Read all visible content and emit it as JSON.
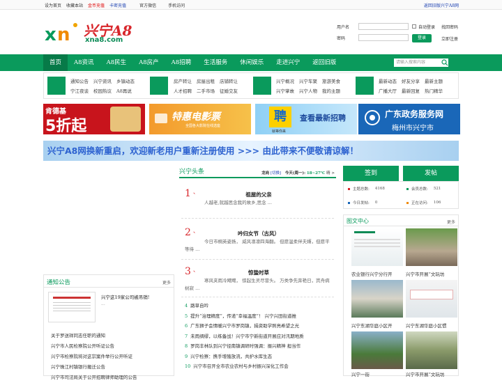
{
  "topbar": {
    "links": [
      "设为首页",
      "收藏本站",
      "金币充值",
      "卡密充值",
      "官方微信",
      "手机访问"
    ],
    "right": "返回旧版兴宁A8网"
  },
  "logo": {
    "cn": "兴宁A8",
    "domain": "xna8.com",
    "mark": "xn"
  },
  "login": {
    "user_label": "用户名",
    "pass_label": "密码",
    "auto_login": "自动登录",
    "find_pass": "找回密码",
    "login_btn": "登录",
    "register": "立即注册"
  },
  "nav": {
    "items": [
      "首页",
      "A8资讯",
      "A8民生",
      "A8房产",
      "A8招聘",
      "生活服务",
      "休闲娱乐",
      "走进兴宁",
      "返回旧版"
    ],
    "search_placeholder": "请输入搜索内容"
  },
  "subnav": {
    "group1": [
      "通知公告",
      "兴宁资讯",
      "乡镇动态",
      "宁江夜谈",
      "校园热议",
      "A8再说"
    ],
    "group2": [
      "房产转让",
      "房屋出租",
      "店铺转让",
      "人才招聘",
      "二手市场",
      "征婚交友"
    ],
    "group3": [
      "兴宁概况",
      "兴宁车聚",
      "旅游美食",
      "兴宁掌故",
      "兴宁人物",
      "我的主题"
    ],
    "group4": [
      "最新动态",
      "好友分享",
      "最新主题",
      "广播大厅",
      "最新回复",
      "热门精华"
    ]
  },
  "banners": {
    "kfc_brand": "肯德基",
    "kfc_deal": "5折起",
    "movie_title": "特惠电影票",
    "movie_sub": "全国各大影院在线选座",
    "job_char": "聘",
    "job_title": "查看最新招聘",
    "job_sub": "就等你来",
    "gov_title": "广东政务服务网",
    "gov_city": "梅州市兴宁市",
    "wide_text": "兴宁A8网换新重启，欢迎新老用户重新注册使用 >>>     由此带来不便敬请谅解！"
  },
  "headline": {
    "title": "兴宁头条",
    "city": "龙岗",
    "switch": "[切换]",
    "weather_label": "今天(周一):",
    "temp": "18~27℃",
    "cond": "晴 >"
  },
  "articles": [
    {
      "num": "1",
      "title": "祖屋的父亲",
      "excerpt": "人越老,就越思念我的故乡,思念 ..."
    },
    {
      "num": "2",
      "title": "吟归女节（古风）",
      "excerpt": "今日市桐英姿扬， 威风凛凛四海翻。 但愿温柔伴夫婿，但愿平等待 ..."
    },
    {
      "num": "3",
      "title": "惊蛰时草",
      "excerpt": "寒风夹雨冷飕飕， 惊起生灵尽冒头。 万类争先奔艳日，宾舟病树寂 ..."
    }
  ],
  "news_list": [
    {
      "n": "4",
      "t": "路草自吟"
    },
    {
      "n": "5",
      "t": "提升“治理精度”，传递“幸福温度”！ 兴宁兴田街道推"
    },
    {
      "n": "6",
      "t": "广东狮子会情暖兴宁市罗岗镇，捐资助学照亮希望之光"
    },
    {
      "n": "7",
      "t": "未雨绸缪，以练备战！兴宁市宁新街道开展应对汛期地质"
    },
    {
      "n": "8",
      "t": "罗岗丰林队到兴宁径南镇调研时强调：振兴精神 担当作"
    },
    {
      "n": "9",
      "t": "兴宁检察：携手增殖放流，共护水库生态"
    },
    {
      "n": "10",
      "t": "兴宁市召开全市农业农村与乡村振兴深化工作会"
    }
  ],
  "notice": {
    "title": "通知公告",
    "more": "更多",
    "top_title": "兴宁这19家公司被吊销!",
    "top_ex": "...",
    "items": [
      "关于罗送祥同志任职的通知",
      "兴宁市人民检察院公开听证公告",
      "兴宁市检察院将对这宗案件举行公开听证",
      "兴宁珠江村镇银行搬迁公告",
      "兴宁市司法局关于公开招聘律师助理的公告"
    ]
  },
  "sign": {
    "checkin": "签到",
    "post": "发帖"
  },
  "stats": {
    "topics_label": "主题总数:",
    "topics": "4168",
    "members_label": "会员总数:",
    "members": "521",
    "today_label": "今日发帖:",
    "today": "0",
    "online_label": "正在访问:",
    "online": "106"
  },
  "pics": {
    "title": "图文中心",
    "more": "更多",
    "captions": [
      "农业银行兴宁分行开",
      "兴宁市开展“文玩坊",
      "兴宁东湖华庭小区开",
      "兴宁东湖华庭小区惯"
    ],
    "bottom": [
      "兴宁一街",
      "兴宁市开展“文玩坊"
    ]
  },
  "colors": {
    "brand": "#0a9a5c",
    "accent_red": "#d8262b"
  }
}
